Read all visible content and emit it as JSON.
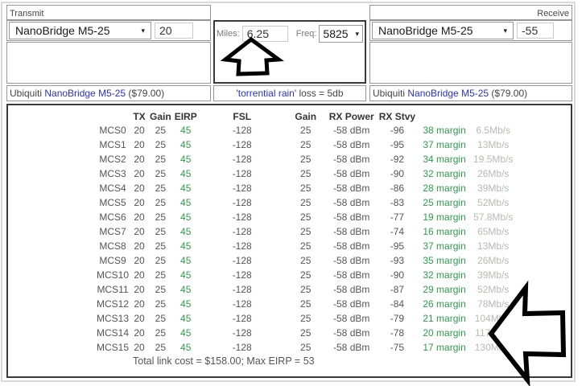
{
  "transmit": {
    "name": "Transmit",
    "device": "NanoBridge M5-25",
    "tx_power": "20",
    "notes": "",
    "price_prefix": "Ubiquiti ",
    "price_link": "NanoBridge M5-25",
    "price_suffix": " ($79.00)"
  },
  "receive": {
    "name": "Receive",
    "device": "NanoBridge M5-25",
    "rx_signal": "-55",
    "notes": "",
    "price_prefix": "Ubiquiti ",
    "price_link": "NanoBridge M5-25",
    "price_suffix": " ($79.00)"
  },
  "link": {
    "miles_label": "Miles:",
    "miles": "6.25",
    "freq_label": "Freq:",
    "freq": "5825",
    "rain_open_quote": "'",
    "rain_link": "torrential rain",
    "rain_suffix": "' loss = 5db"
  },
  "table": {
    "headers": [
      "",
      "TX",
      "Gain",
      "EIRP",
      "FSL",
      "Gain",
      "RX Power",
      "RX Stvy",
      "",
      ""
    ],
    "rows": [
      [
        "MCS0",
        "20",
        "25",
        "45",
        "-128",
        "25",
        "-58 dBm",
        "-96",
        "38 margin",
        "6.5Mb/s"
      ],
      [
        "MCS1",
        "20",
        "25",
        "45",
        "-128",
        "25",
        "-58 dBm",
        "-95",
        "37 margin",
        "13Mb/s"
      ],
      [
        "MCS2",
        "20",
        "25",
        "45",
        "-128",
        "25",
        "-58 dBm",
        "-92",
        "34 margin",
        "19.5Mb/s"
      ],
      [
        "MCS3",
        "20",
        "25",
        "45",
        "-128",
        "25",
        "-58 dBm",
        "-90",
        "32 margin",
        "26Mb/s"
      ],
      [
        "MCS4",
        "20",
        "25",
        "45",
        "-128",
        "25",
        "-58 dBm",
        "-86",
        "28 margin",
        "39Mb/s"
      ],
      [
        "MCS5",
        "20",
        "25",
        "45",
        "-128",
        "25",
        "-58 dBm",
        "-83",
        "25 margin",
        "52Mb/s"
      ],
      [
        "MCS6",
        "20",
        "25",
        "45",
        "-128",
        "25",
        "-58 dBm",
        "-77",
        "19 margin",
        "57.8Mb/s"
      ],
      [
        "MCS7",
        "20",
        "25",
        "45",
        "-128",
        "25",
        "-58 dBm",
        "-74",
        "16 margin",
        "65Mb/s"
      ],
      [
        "MCS8",
        "20",
        "25",
        "45",
        "-128",
        "25",
        "-58 dBm",
        "-95",
        "37 margin",
        "13Mb/s"
      ],
      [
        "MCS9",
        "20",
        "25",
        "45",
        "-128",
        "25",
        "-58 dBm",
        "-93",
        "35 margin",
        "26Mb/s"
      ],
      [
        "MCS10",
        "20",
        "25",
        "45",
        "-128",
        "25",
        "-58 dBm",
        "-90",
        "32 margin",
        "39Mb/s"
      ],
      [
        "MCS11",
        "20",
        "25",
        "45",
        "-128",
        "25",
        "-58 dBm",
        "-87",
        "29 margin",
        "52Mb/s"
      ],
      [
        "MCS12",
        "20",
        "25",
        "45",
        "-128",
        "25",
        "-58 dBm",
        "-84",
        "26 margin",
        "78Mb/s"
      ],
      [
        "MCS13",
        "20",
        "25",
        "45",
        "-128",
        "25",
        "-58 dBm",
        "-79",
        "21 margin",
        "104Mb/s"
      ],
      [
        "MCS14",
        "20",
        "25",
        "45",
        "-128",
        "25",
        "-58 dBm",
        "-78",
        "20 margin",
        "117Mb/s"
      ],
      [
        "MCS15",
        "20",
        "25",
        "45",
        "-128",
        "25",
        "-58 dBm",
        "-75",
        "17 margin",
        "130Mb/s"
      ]
    ],
    "footer": "Total link cost = $158.00; Max EIRP = 53"
  },
  "icons": {
    "dropdown_arrow": "▾"
  },
  "colors": {
    "accent_green": "#2e9e49",
    "link_blue": "#2b32cc",
    "rate_gray": "#b3bcb3"
  }
}
